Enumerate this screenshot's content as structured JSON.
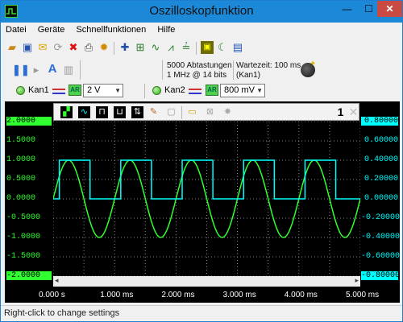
{
  "window": {
    "title": "Oszilloskopfunktion",
    "minimize": "—",
    "maximize": "☐",
    "close": "✕"
  },
  "menu": {
    "items": [
      "Datei",
      "Geräte",
      "Schnellfunktionen",
      "Hilfe"
    ]
  },
  "acquisition": {
    "samples": "5000 Abtastungen",
    "rate": "1 MHz @ 14 bits",
    "wait": "Wartezeit: 100 ms",
    "wait_channel": "(Kan1)"
  },
  "channel1": {
    "label": "Kan1",
    "auto_range": "AR",
    "range": "2 V",
    "color": "#30ff30"
  },
  "channel2": {
    "label": "Kan2",
    "auto_range": "AR",
    "range": "800 mV",
    "color": "#00ffff"
  },
  "scope": {
    "cursor_count": "1",
    "left_axis": [
      "2.0000",
      "1.5000",
      "1.0000",
      "0.5000",
      "0.0000",
      "-0.5000",
      "-1.0000",
      "-1.5000",
      "-2.0000"
    ],
    "right_axis": [
      "0.80000",
      "0.60000",
      "0.40000",
      "0.20000",
      "0.00000",
      "-0.20000",
      "-0.40000",
      "-0.60000",
      "-0.80000"
    ],
    "time_axis": [
      "0.000 s",
      "1.000 ms",
      "2.000 ms",
      "3.000 ms",
      "4.000 ms",
      "5.000 ms"
    ],
    "background": "#000000",
    "grid_color": "#8c8c8c"
  },
  "chart_data": {
    "type": "line",
    "x_range_ms": [
      0,
      5
    ],
    "series": [
      {
        "name": "Kan1",
        "color": "#30ff30",
        "waveform": "sine",
        "amplitude_V": 1.0,
        "frequency_kHz": 1.0,
        "phase_peak_ms": 0.25,
        "ylim": [
          -2,
          2
        ]
      },
      {
        "name": "Kan2",
        "color": "#00ffff",
        "waveform": "square",
        "high_V": 0.4,
        "low_V": 0.0,
        "frequency_kHz": 1.0,
        "ylim": [
          -0.8,
          0.8
        ]
      }
    ]
  },
  "status": {
    "text": "Right-click to change settings"
  }
}
